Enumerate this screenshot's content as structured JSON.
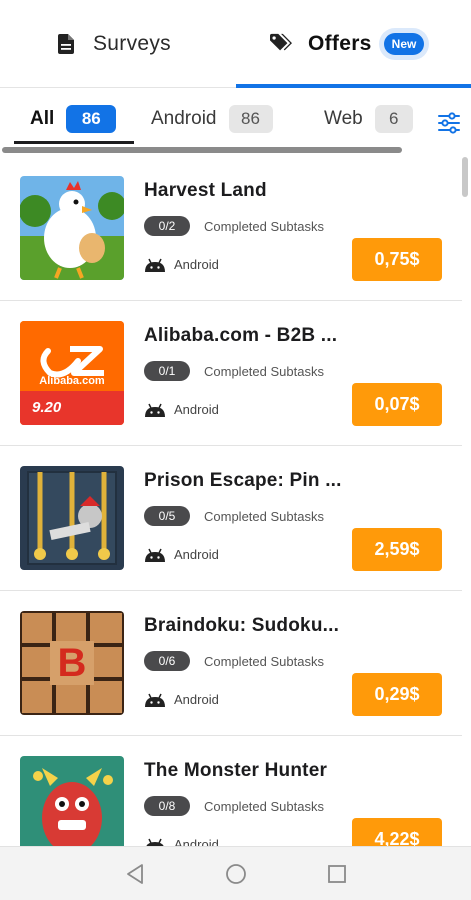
{
  "top_tabs": [
    {
      "label": "Surveys",
      "icon": "document-icon"
    },
    {
      "label": "Offers",
      "icon": "tags-icon",
      "badge": "New"
    }
  ],
  "filters": [
    {
      "label": "All",
      "count": "86"
    },
    {
      "label": "Android",
      "count": "86"
    },
    {
      "label": "Web",
      "count": "6"
    }
  ],
  "offers": [
    {
      "title": "Harvest Land",
      "progress": "0/2",
      "subtasks_label": "Completed Subtasks",
      "platform": "Android",
      "price": "0,75$"
    },
    {
      "title": "Alibaba.com - B2B ...",
      "progress": "0/1",
      "subtasks_label": "Completed Subtasks",
      "platform": "Android",
      "price": "0,07$"
    },
    {
      "title": "Prison Escape: Pin ...",
      "progress": "0/5",
      "subtasks_label": "Completed Subtasks",
      "platform": "Android",
      "price": "2,59$"
    },
    {
      "title": "Braindoku: Sudoku...",
      "progress": "0/6",
      "subtasks_label": "Completed Subtasks",
      "platform": "Android",
      "price": "0,29$"
    },
    {
      "title": "The Monster Hunter",
      "progress": "0/8",
      "subtasks_label": "Completed Subtasks",
      "platform": "Android",
      "price": "4,22$"
    }
  ],
  "thumb_text": {
    "alibaba_logo": "Alibaba.com",
    "alibaba_promo": "9.20",
    "braindoku_letter": "B"
  },
  "colors": {
    "accent_blue": "#1273e6",
    "price_orange": "#ff9a0a",
    "progress_pill": "#4a4a4c"
  }
}
